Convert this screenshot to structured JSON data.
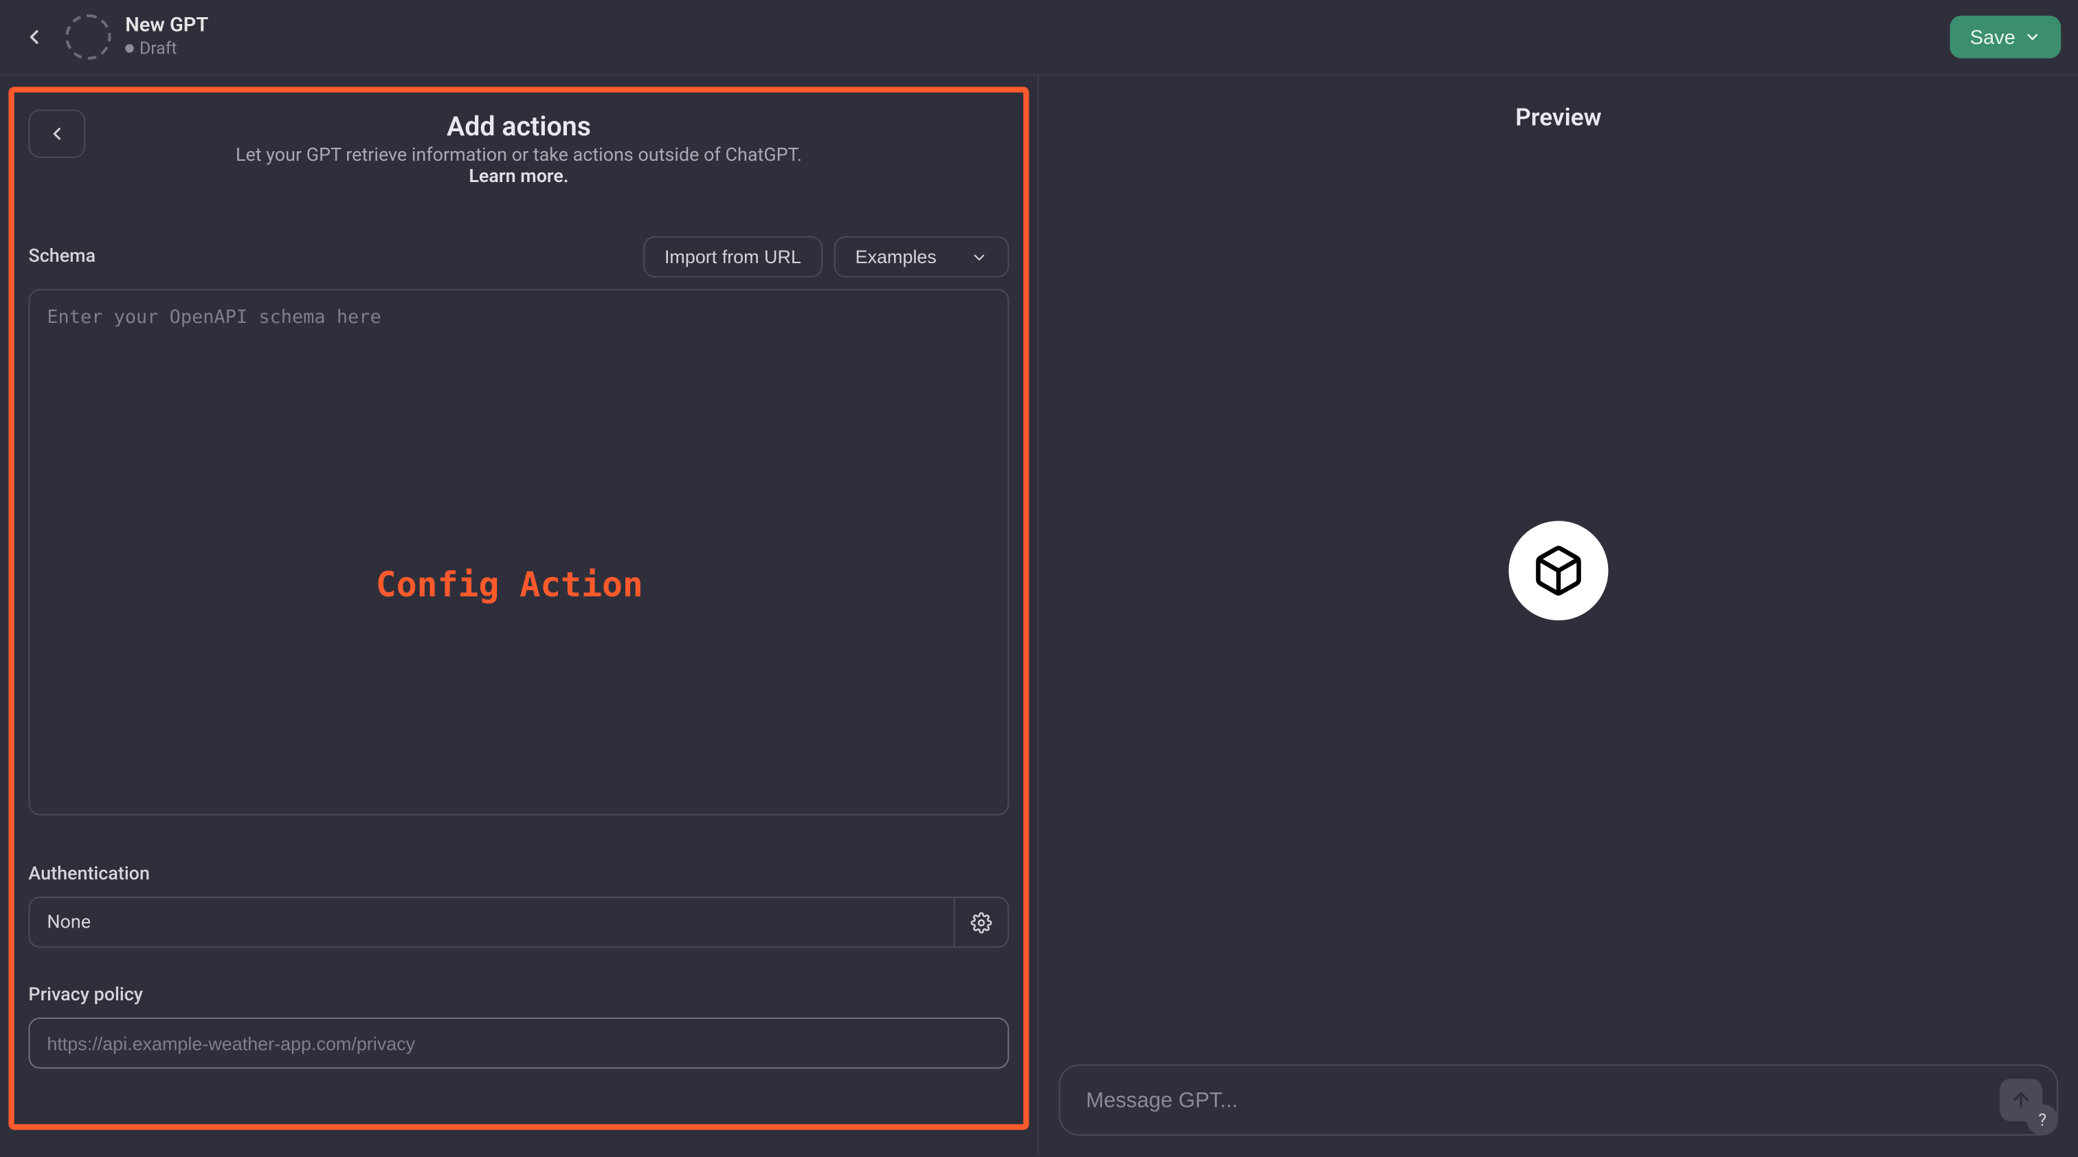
{
  "header": {
    "title": "New GPT",
    "status": "Draft",
    "save_label": "Save"
  },
  "actions_panel": {
    "title": "Add actions",
    "description": "Let your GPT retrieve information or take actions outside of ChatGPT.",
    "learn_more_label": "Learn more.",
    "schema_label": "Schema",
    "import_url_label": "Import from URL",
    "examples_label": "Examples",
    "schema_placeholder": "Enter your OpenAPI schema here",
    "overlay_text": "Config Action",
    "auth_label": "Authentication",
    "auth_value": "None",
    "privacy_label": "Privacy policy",
    "privacy_placeholder": "https://api.example-weather-app.com/privacy"
  },
  "preview": {
    "title": "Preview",
    "message_placeholder": "Message GPT...",
    "help_label": "?"
  }
}
